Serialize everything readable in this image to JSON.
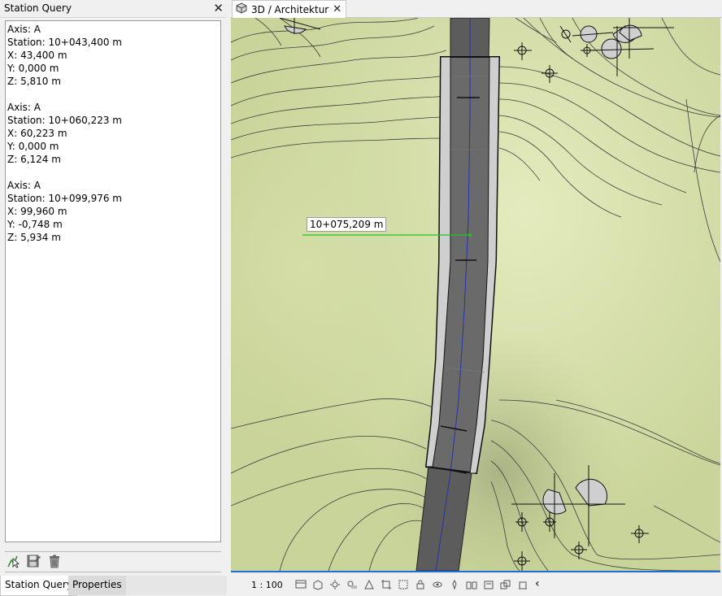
{
  "panel": {
    "title": "Station Query",
    "close": "✕"
  },
  "results": [
    {
      "axis": "Axis: A",
      "station": "Station: 10+043,400 m",
      "x": "X: 43,400 m",
      "y": "Y: 0,000 m",
      "z": "Z: 5,810 m"
    },
    {
      "axis": "Axis: A",
      "station": "Station: 10+060,223 m",
      "x": "X: 60,223 m",
      "y": "Y: 0,000 m",
      "z": "Z: 6,124 m"
    },
    {
      "axis": "Axis: A",
      "station": "Station: 10+099,976 m",
      "x": "X: 99,960 m",
      "y": "Y: -0,748 m",
      "z": "Z: 5,934 m"
    }
  ],
  "toolbar": {
    "pick_icon": "pick-station-icon",
    "save_icon": "save-icon",
    "delete_icon": "trash-icon"
  },
  "tabs": {
    "station_query": "Station Query",
    "properties": "Properties"
  },
  "doc": {
    "tab_label": "3D / Architektur",
    "close": "✕",
    "cursor_station": "10+075,209 m"
  },
  "status": {
    "scale": "1 : 100",
    "collapse": "‹"
  },
  "colors": {
    "terrain": "#c9d49a",
    "road": "#5c5c5c",
    "selection_blue": "#1e6fd9",
    "measure_green": "#22c422"
  }
}
